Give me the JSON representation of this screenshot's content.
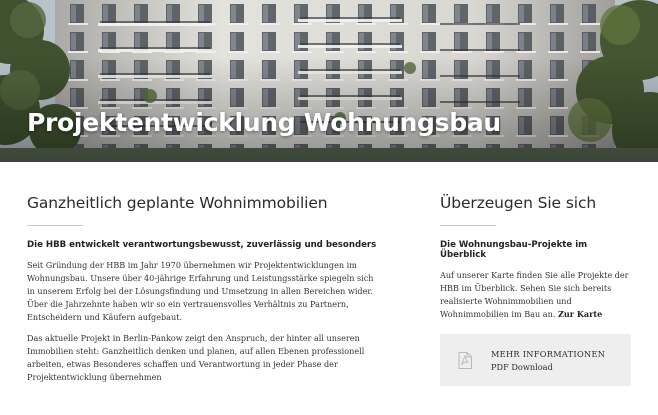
{
  "hero": {
    "title": "Projektentwicklung Wohnungsbau"
  },
  "left": {
    "heading": "Ganzheitlich geplante Wohnimmobilien",
    "subheading": "Die HBB entwickelt verantwortungsbewusst, zuverlässig und besonders",
    "paragraphs": [
      "Seit Gründung der HBB im Jahr 1970 übernehmen wir Projektentwicklungen im Wohnungsbau. Unsere über 40-jährige Erfahrung und Leistungsstärke spiegeln sich in unserem Erfolg bei der Lösungsfindung und Umsetzung in allen Bereichen wider. Über die Jahrzehnte haben wir so ein vertrauensvolles Verhältnis zu Partnern, Entscheidern und Käufern aufgebaut.",
      "Das aktuelle Projekt in Berlin-Pankow zeigt den Anspruch, der hinter all unseren Immobilien steht: Ganzheitlich denken und planen, auf allen Ebenen professionell arbeiten, etwas Besonderes schaffen und Verantwortung in jeder Phase der Projektentwicklung übernehmen"
    ]
  },
  "right": {
    "heading": "Überzeugen Sie sich",
    "subheading": "Die Wohnungsbau-Projekte im Überblick",
    "paragraph": "Auf unserer Karte finden Sie alle Projekte der HBB im Überblick. Sehen Sie sich bereits realisierte Wohnimmobilien und Wohnimmobilien im Bau an.",
    "link_label": "Zur Karte"
  },
  "download": {
    "icon": "pdf-file-icon",
    "title": "MEHR INFORMATIONEN",
    "subtitle": "PDF Download"
  }
}
